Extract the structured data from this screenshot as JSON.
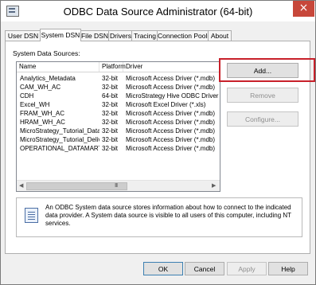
{
  "window": {
    "title": "ODBC Data Source Administrator (64-bit)",
    "close_glyph": "×"
  },
  "tabs": [
    {
      "label": "User DSN"
    },
    {
      "label": "System DSN"
    },
    {
      "label": "File DSN"
    },
    {
      "label": "Drivers"
    },
    {
      "label": "Tracing"
    },
    {
      "label": "Connection Pooling"
    },
    {
      "label": "About"
    }
  ],
  "active_tab": "System DSN",
  "section_label": "System Data Sources:",
  "columns": [
    "Name",
    "Platform",
    "Driver"
  ],
  "rows": [
    {
      "name": "Analytics_Metadata",
      "platform": "32-bit",
      "driver": "Microsoft Access Driver (*.mdb)"
    },
    {
      "name": "CAM_WH_AC",
      "platform": "32-bit",
      "driver": "Microsoft Access Driver (*.mdb)"
    },
    {
      "name": "CDH",
      "platform": "64-bit",
      "driver": "MicroStrategy Hive ODBC Driver"
    },
    {
      "name": "Excel_WH",
      "platform": "32-bit",
      "driver": "Microsoft Excel Driver (*.xls)"
    },
    {
      "name": "FRAM_WH_AC",
      "platform": "32-bit",
      "driver": "Microsoft Access Driver (*.mdb)"
    },
    {
      "name": "HRAM_WH_AC",
      "platform": "32-bit",
      "driver": "Microsoft Access Driver (*.mdb)"
    },
    {
      "name": "MicroStrategy_Tutorial_Data",
      "platform": "32-bit",
      "driver": "Microsoft Access Driver (*.mdb)"
    },
    {
      "name": "MicroStrategy_Tutorial_Delivery",
      "platform": "32-bit",
      "driver": "Microsoft Access Driver (*.mdb)"
    },
    {
      "name": "OPERATIONAL_DATAMART",
      "platform": "32-bit",
      "driver": "Microsoft Access Driver (*.mdb)"
    }
  ],
  "scrollbar": {
    "left_arrow": "◀",
    "right_arrow": "▶",
    "grip": "III"
  },
  "side_buttons": {
    "add": "Add...",
    "remove": "Remove",
    "configure": "Configure..."
  },
  "info_text": "An ODBC System data source stores information about how to connect to the indicated data provider. A System data source is visible to all users of this computer, including NT services.",
  "bottom_buttons": {
    "ok": "OK",
    "cancel": "Cancel",
    "apply": "Apply",
    "help": "Help"
  },
  "colors": {
    "highlight": "#c8202a",
    "close_button": "#c7473a"
  },
  "icons": {
    "app": "odbc-admin-icon",
    "info": "data-source-info-icon"
  }
}
